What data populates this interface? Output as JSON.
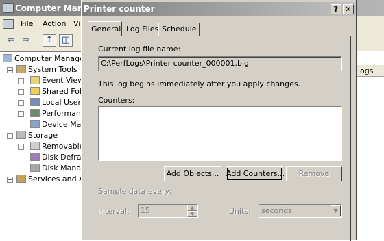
{
  "background_window": {
    "title": "Computer Manage",
    "menu": [
      "File",
      "Action",
      "Vi"
    ],
    "tree": {
      "root": "Computer Manager",
      "system_tools": "System Tools",
      "event_viewer": "Event Viewe",
      "shared_folders": "Shared Fold",
      "local_users": "Local Users",
      "performance": "Performance",
      "device_manager": "Device Mar",
      "storage": "Storage",
      "removable": "Removable",
      "disk_defrag": "Disk Defrag",
      "disk_management": "Disk Manag",
      "services": "Services and A"
    },
    "right_header": "ogs"
  },
  "dialog": {
    "title": "Printer counter",
    "help_btn": "?",
    "close_btn": "✕",
    "tabs": [
      "General",
      "Log Files",
      "Schedule"
    ],
    "active_tab": "General",
    "current_log_label": "Current log file name:",
    "current_log_value": "C:\\PerfLogs\\Printer counter_000001.blg",
    "info_text": "This log begins immediately after you apply changes.",
    "counters_label": "Counters:",
    "buttons": {
      "add_objects": "Add Objects...",
      "add_counters": "Add Counters...",
      "remove": "Remove"
    },
    "sample_label": "Sample data every:",
    "interval_label": "Interval:",
    "interval_value": "15",
    "units_label": "Units:",
    "units_value": "seconds"
  }
}
